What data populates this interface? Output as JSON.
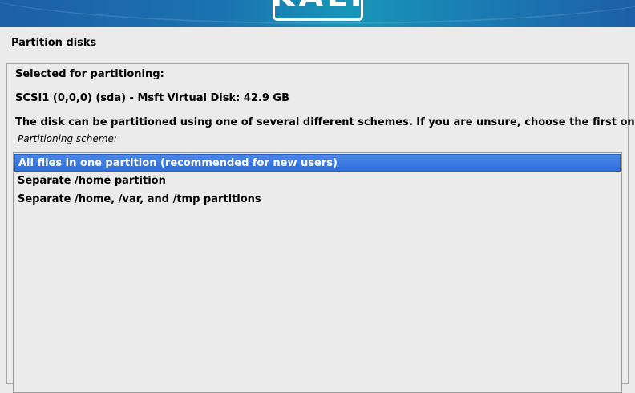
{
  "banner": {
    "logo_text": "KALI"
  },
  "page": {
    "title": "Partition disks"
  },
  "panel": {
    "selected_label": "Selected for partitioning:",
    "disk": "SCSI1 (0,0,0) (sda) - Msft Virtual Disk: 42.9 GB",
    "description": "The disk can be partitioned using one of several different schemes. If you are unsure, choose the first one.",
    "scheme_label": "Partitioning scheme:"
  },
  "schemes": {
    "items": [
      {
        "label": "All files in one partition (recommended for new users)",
        "selected": true
      },
      {
        "label": "Separate /home partition",
        "selected": false
      },
      {
        "label": "Separate /home, /var, and /tmp partitions",
        "selected": false
      }
    ]
  },
  "colors": {
    "selection": "#3a78e0",
    "banner": "#1a73b0"
  }
}
